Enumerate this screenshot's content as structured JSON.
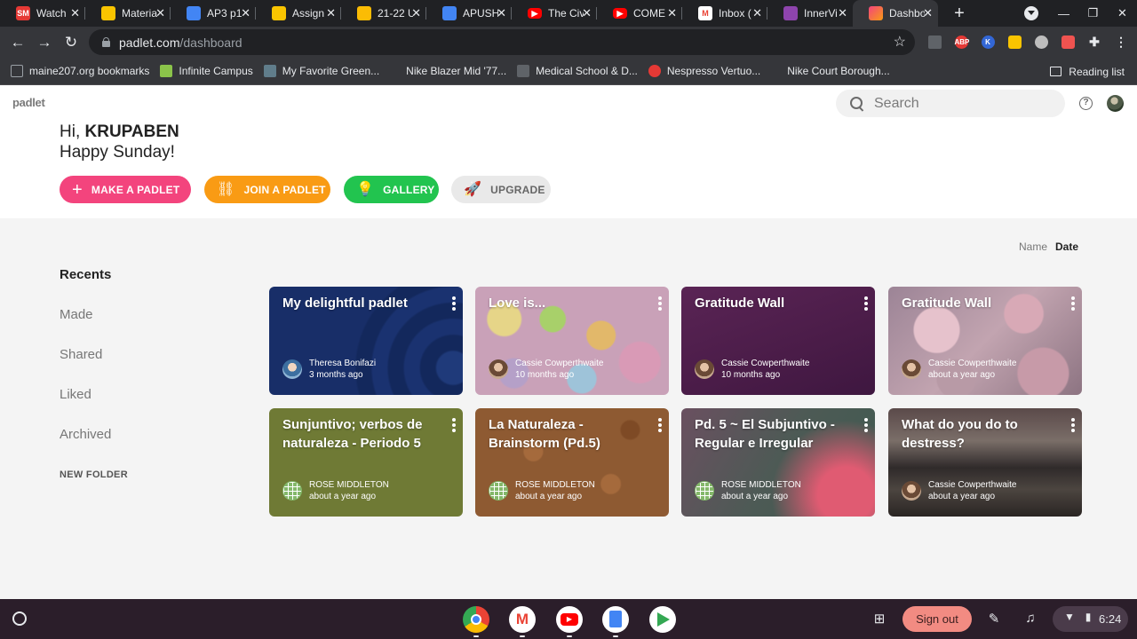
{
  "browser": {
    "tabs": [
      {
        "title": "Watch",
        "favicon_color": "#e53935",
        "favicon_text": "SM"
      },
      {
        "title": "Materia",
        "favicon_color": "#f9c400",
        "favicon_text": ""
      },
      {
        "title": "AP3 p1",
        "favicon_color": "#4285f4",
        "favicon_text": ""
      },
      {
        "title": "Assign",
        "favicon_color": "#f9c400",
        "favicon_text": ""
      },
      {
        "title": "21-22 U",
        "favicon_color": "#fbbc04",
        "favicon_text": ""
      },
      {
        "title": "APUSH",
        "favicon_color": "#4285f4",
        "favicon_text": ""
      },
      {
        "title": "The Civ",
        "favicon_color": "#ff0000",
        "favicon_text": ""
      },
      {
        "title": "COME",
        "favicon_color": "#ff0000",
        "favicon_text": ""
      },
      {
        "title": "Inbox (",
        "favicon_color": "#ea4335",
        "favicon_text": "M"
      },
      {
        "title": "InnerVi",
        "favicon_color": "#8e44ad",
        "favicon_text": ""
      },
      {
        "title": "Dashbo",
        "favicon_color": "#f3447d",
        "favicon_text": ""
      }
    ],
    "address": {
      "host": "padlet.com",
      "path": "/dashboard"
    },
    "bookmarks": [
      {
        "label": "maine207.org bookmarks",
        "color": "#9aa0a6"
      },
      {
        "label": "Infinite Campus",
        "color": "#8bc34a"
      },
      {
        "label": "My Favorite Green...",
        "color": "#607d8b"
      },
      {
        "label": "Nike Blazer Mid '77...",
        "color": "transparent"
      },
      {
        "label": "Medical School & D...",
        "color": "#5f6368"
      },
      {
        "label": "Nespresso Vertuo...",
        "color": "#e53935"
      },
      {
        "label": "Nike Court Borough...",
        "color": "transparent"
      }
    ],
    "reading_list": "Reading list"
  },
  "padlet": {
    "logo": "padlet",
    "search_placeholder": "Search",
    "help": "?",
    "greeting_prefix": "Hi, ",
    "user_name": "KRUPABEN",
    "greeting_line2": "Happy Sunday!",
    "buttons": {
      "make": "MAKE A PADLET",
      "join": "JOIN A PADLET",
      "gallery": "GALLERY",
      "upgrade": "UPGRADE"
    },
    "sort": {
      "name": "Name",
      "date": "Date"
    },
    "nav": {
      "recents": "Recents",
      "made": "Made",
      "shared": "Shared",
      "liked": "Liked",
      "archived": "Archived",
      "new_folder": "NEW FOLDER"
    },
    "cards": [
      {
        "title": "My delightful padlet",
        "author": "Theresa Bonifazi",
        "time": "3 months ago"
      },
      {
        "title": "Love is...",
        "author": "Cassie Cowperthwaite",
        "time": "10 months ago"
      },
      {
        "title": "Gratitude Wall",
        "author": "Cassie Cowperthwaite",
        "time": "10 months ago"
      },
      {
        "title": "Gratitude Wall",
        "author": "Cassie Cowperthwaite",
        "time": "about a year ago"
      },
      {
        "title": "Sunjuntivo; verbos de naturaleza - Periodo 5",
        "author": "ROSE MIDDLETON",
        "time": "about a year ago"
      },
      {
        "title": "La Naturaleza - Brainstorm (Pd.5)",
        "author": "ROSE MIDDLETON",
        "time": "about a year ago"
      },
      {
        "title": "Pd. 5 ~ El Subjuntivo - Regular e Irregular",
        "author": "ROSE MIDDLETON",
        "time": "about a year ago"
      },
      {
        "title": "What do you do to destress?",
        "author": "Cassie Cowperthwaite",
        "time": "about a year ago"
      }
    ]
  },
  "shelf": {
    "sign_out": "Sign out",
    "time": "6:24"
  },
  "colors": {
    "make": "#f3447d",
    "join": "#f99b14",
    "gallery": "#22c44f",
    "upgrade": "#e9e9e9"
  }
}
